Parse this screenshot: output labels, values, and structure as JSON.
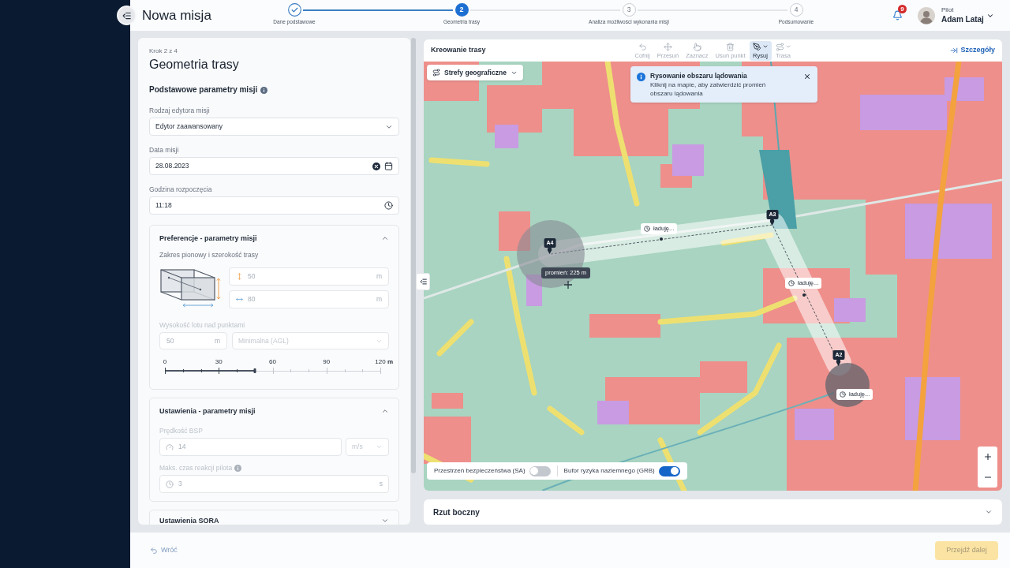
{
  "header": {
    "title": "Nowa misja",
    "steps": [
      {
        "label": "Dane podstawowe",
        "completed": true,
        "selected": false
      },
      {
        "number": "2",
        "label": "Geometria trasy",
        "completed": false,
        "selected": true
      },
      {
        "number": "3",
        "label": "Analiza możliwości wykonania misji",
        "completed": false,
        "selected": false
      },
      {
        "number": "4",
        "label": "Podsumowanie",
        "completed": false,
        "selected": false
      }
    ],
    "notification_count": "9",
    "user": {
      "role": "Pilot",
      "name": "Adam Lataj"
    }
  },
  "form": {
    "step": "Krok 2 z 4",
    "title": "Geometria trasy",
    "section_title": "Podstawowe parametry misji",
    "fields": [
      {
        "kind": "select",
        "label": "Rodzaj edytora misji",
        "value": "Edytor zaawansowany",
        "disabled": false
      },
      {
        "kind": "date",
        "label": "Data misji",
        "value": "28.08.2023",
        "disabled": false
      },
      {
        "kind": "time",
        "label": "Godzina rozpoczęcia",
        "value": "11:18",
        "disabled": false
      }
    ],
    "preferences": {
      "title": "Preferencje - parametry misji",
      "expanded": true,
      "corridor_label": "Zakres pionowy i szerokość trasy",
      "corridor_fields": [
        {
          "kind": "height",
          "value": "50",
          "unit": "m",
          "disabled": true
        },
        {
          "kind": "width",
          "value": "80",
          "unit": "m",
          "disabled": true
        }
      ],
      "altitude_label": "Wysokość lotu nad punktami",
      "altitude": {
        "value": "50",
        "unit": "m",
        "disabled": true
      },
      "altitude_mode": {
        "value": "Minimalna (AGL)",
        "disabled": true
      },
      "scale": {
        "ticks": [
          "0",
          "30",
          "60",
          "90",
          "120"
        ],
        "unit": "m",
        "level": 0.417
      }
    },
    "settings": {
      "title": "Ustawienia - parametry misji",
      "expanded": true,
      "speed": {
        "label": "Prędkość BSP",
        "value": "14",
        "unit": "m/s",
        "disabled": true
      },
      "reaction": {
        "label": "Maks. czas reakcji pilota",
        "value": "3",
        "unit": "s",
        "disabled": true
      }
    },
    "sora": {
      "title": "Ustawienia SORA",
      "expanded": false
    }
  },
  "map_panel": {
    "title": "Kreowanie trasy",
    "tools": [
      {
        "label": "Cofnij",
        "selected": false,
        "disabled": true,
        "dropdown": false
      },
      {
        "label": "Przesuń",
        "selected": false,
        "disabled": true,
        "dropdown": false
      },
      {
        "label": "Zaznacz",
        "selected": false,
        "disabled": true,
        "dropdown": false
      },
      {
        "label": "Usuń punkt",
        "selected": false,
        "disabled": true,
        "dropdown": false
      },
      {
        "label": "Rysuj",
        "selected": true,
        "disabled": false,
        "dropdown": true
      },
      {
        "label": "Trasa",
        "selected": false,
        "disabled": true,
        "dropdown": true
      }
    ],
    "details_link": "Szczegóły",
    "layers_button": "Strefy geograficzne",
    "toast": {
      "title": "Rysowanie obszaru lądowania",
      "message": "Kliknij na mapie, aby zatwierdzić promień obszaru lądowania"
    },
    "waypoints": [
      "A4",
      "A3",
      "A2"
    ],
    "loading_chips": [
      "ładuję...",
      "ładuję...",
      "ładuję..."
    ],
    "radius_label": "promień: 225 m",
    "toggles": [
      {
        "label": "Przestrzeń bezpieczeństwa (SA)",
        "on": false
      },
      {
        "label": "Bufor ryzyka naziemnego (GRB)",
        "on": true
      }
    ]
  },
  "side_view": {
    "title": "Rzut boczny",
    "expanded": false
  },
  "footer": {
    "back": "Wróć",
    "next": {
      "label": "Przejdź dalej",
      "disabled": true
    }
  }
}
